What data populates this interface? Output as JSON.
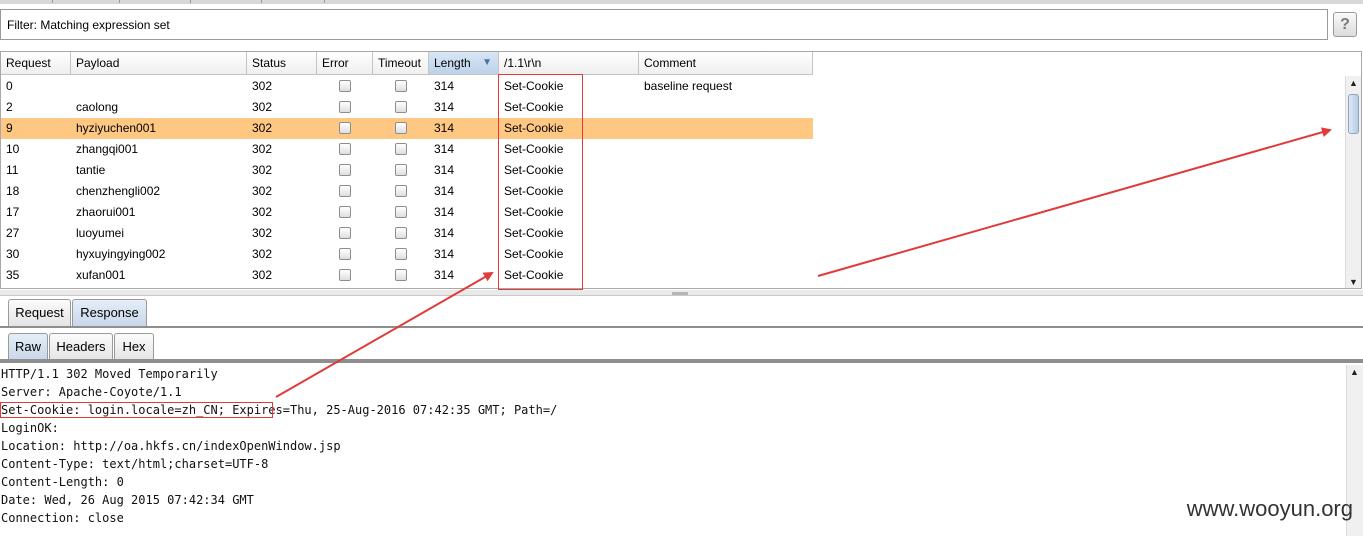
{
  "filter": {
    "text": "Filter: Matching expression set",
    "help_label": "?"
  },
  "table": {
    "columns": [
      "Request",
      "Payload",
      "Status",
      "Error",
      "Timeout",
      "Length",
      "/1.1\\r\\n",
      "Comment"
    ],
    "sorted_column": "Length",
    "rows": [
      {
        "request": "0",
        "payload": "",
        "status": "302",
        "error": false,
        "timeout": false,
        "length": "314",
        "match": "Set-Cookie",
        "comment": "baseline request",
        "selected": false
      },
      {
        "request": "2",
        "payload": "caolong",
        "status": "302",
        "error": false,
        "timeout": false,
        "length": "314",
        "match": "Set-Cookie",
        "comment": "",
        "selected": false
      },
      {
        "request": "9",
        "payload": "hyziyuchen001",
        "status": "302",
        "error": false,
        "timeout": false,
        "length": "314",
        "match": "Set-Cookie",
        "comment": "",
        "selected": true
      },
      {
        "request": "10",
        "payload": "zhangqi001",
        "status": "302",
        "error": false,
        "timeout": false,
        "length": "314",
        "match": "Set-Cookie",
        "comment": "",
        "selected": false
      },
      {
        "request": "11",
        "payload": "tantie",
        "status": "302",
        "error": false,
        "timeout": false,
        "length": "314",
        "match": "Set-Cookie",
        "comment": "",
        "selected": false
      },
      {
        "request": "18",
        "payload": "chenzhengli002",
        "status": "302",
        "error": false,
        "timeout": false,
        "length": "314",
        "match": "Set-Cookie",
        "comment": "",
        "selected": false
      },
      {
        "request": "17",
        "payload": "zhaorui001",
        "status": "302",
        "error": false,
        "timeout": false,
        "length": "314",
        "match": "Set-Cookie",
        "comment": "",
        "selected": false
      },
      {
        "request": "27",
        "payload": "luoyumei",
        "status": "302",
        "error": false,
        "timeout": false,
        "length": "314",
        "match": "Set-Cookie",
        "comment": "",
        "selected": false
      },
      {
        "request": "30",
        "payload": "hyxuyingying002",
        "status": "302",
        "error": false,
        "timeout": false,
        "length": "314",
        "match": "Set-Cookie",
        "comment": "",
        "selected": false
      },
      {
        "request": "35",
        "payload": "xufan001",
        "status": "302",
        "error": false,
        "timeout": false,
        "length": "314",
        "match": "Set-Cookie",
        "comment": "",
        "selected": false
      }
    ]
  },
  "message_tabs": [
    "Request",
    "Response"
  ],
  "active_message_tab": "Response",
  "view_tabs": [
    "Raw",
    "Headers",
    "Hex"
  ],
  "active_view_tab": "Raw",
  "response_lines": [
    "HTTP/1.1 302 Moved Temporarily",
    "Server: Apache-Coyote/1.1",
    "Set-Cookie: login.locale=zh_CN; Expires=Thu, 25-Aug-2016 07:42:35 GMT; Path=/",
    "LoginOK:",
    "Location: http://oa.hkfs.cn/indexOpenWindow.jsp",
    "Content-Type: text/html;charset=UTF-8",
    "Content-Length: 0",
    "Date: Wed, 26 Aug 2015 07:42:34 GMT",
    "Connection: close"
  ],
  "watermark": "www.wooyun.org",
  "annotation_color": "#e03a3a"
}
